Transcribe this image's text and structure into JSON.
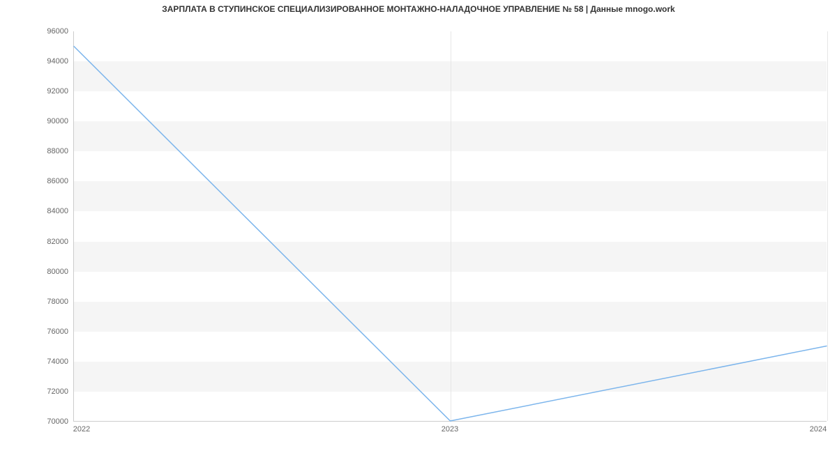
{
  "chart_data": {
    "type": "line",
    "title": "ЗАРПЛАТА В  СТУПИНСКОЕ СПЕЦИАЛИЗИРОВАННОЕ МОНТАЖНО-НАЛАДОЧНОЕ УПРАВЛЕНИЕ № 58 | Данные mnogo.work",
    "xlabel": "",
    "ylabel": "",
    "x": [
      "2022",
      "2023",
      "2024"
    ],
    "values": [
      95000,
      70000,
      75000
    ],
    "y_ticks": [
      70000,
      72000,
      74000,
      76000,
      78000,
      80000,
      82000,
      84000,
      86000,
      88000,
      90000,
      92000,
      94000,
      96000
    ],
    "ylim": [
      70000,
      96000
    ],
    "series_color": "#7cb5ec",
    "grid_bands": true
  }
}
